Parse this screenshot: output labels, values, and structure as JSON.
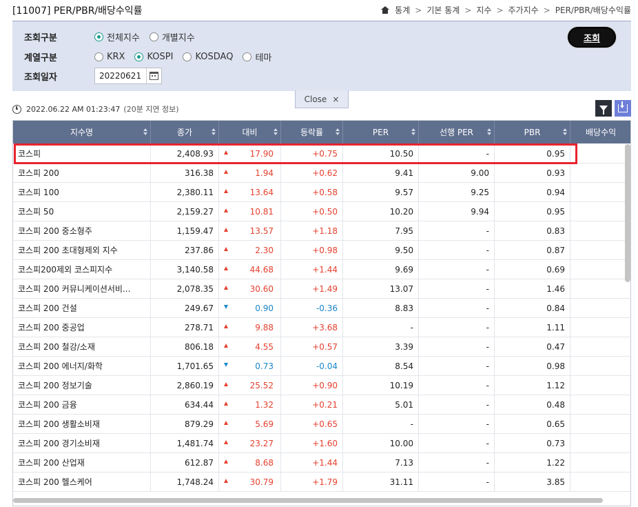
{
  "header": {
    "title": "[11007] PER/PBR/배당수익률",
    "breadcrumb": [
      "통계",
      "기본 통계",
      "지수",
      "주가지수",
      "PER/PBR/배당수익률"
    ]
  },
  "search": {
    "type_label": "조회구분",
    "type_options": [
      {
        "label": "전체지수",
        "checked": true
      },
      {
        "label": "개별지수",
        "checked": false
      }
    ],
    "series_label": "계열구분",
    "series_options": [
      {
        "label": "KRX",
        "checked": false
      },
      {
        "label": "KOSPI",
        "checked": true
      },
      {
        "label": "KOSDAQ",
        "checked": false
      },
      {
        "label": "테마",
        "checked": false
      }
    ],
    "date_label": "조회일자",
    "date_value": "20220621",
    "search_button": "조회",
    "close_tab": "Close"
  },
  "timestamp": {
    "time": "2022.06.22 AM 01:23:47",
    "note": "(20분 지연 정보)"
  },
  "table": {
    "columns": [
      "지수명",
      "종가",
      "대비",
      "등락률",
      "PER",
      "선행 PER",
      "PBR",
      "배당수익"
    ],
    "rows": [
      {
        "name": "코스피",
        "close": "2,408.93",
        "dir": "up",
        "change": "17.90",
        "rate": "+0.75",
        "per": "10.50",
        "fper": "-",
        "pbr": "0.95"
      },
      {
        "name": "코스피 200",
        "close": "316.38",
        "dir": "up",
        "change": "1.94",
        "rate": "+0.62",
        "per": "9.41",
        "fper": "9.00",
        "pbr": "0.93"
      },
      {
        "name": "코스피 100",
        "close": "2,380.11",
        "dir": "up",
        "change": "13.64",
        "rate": "+0.58",
        "per": "9.57",
        "fper": "9.25",
        "pbr": "0.94"
      },
      {
        "name": "코스피 50",
        "close": "2,159.27",
        "dir": "up",
        "change": "10.81",
        "rate": "+0.50",
        "per": "10.20",
        "fper": "9.94",
        "pbr": "0.95"
      },
      {
        "name": "코스피 200 중소형주",
        "close": "1,159.47",
        "dir": "up",
        "change": "13.57",
        "rate": "+1.18",
        "per": "7.95",
        "fper": "-",
        "pbr": "0.83"
      },
      {
        "name": "코스피 200 초대형제외 지수",
        "close": "237.86",
        "dir": "up",
        "change": "2.30",
        "rate": "+0.98",
        "per": "9.50",
        "fper": "-",
        "pbr": "0.87"
      },
      {
        "name": "코스피200제외 코스피지수",
        "close": "3,140.58",
        "dir": "up",
        "change": "44.68",
        "rate": "+1.44",
        "per": "9.69",
        "fper": "-",
        "pbr": "0.69"
      },
      {
        "name": "코스피 200 커뮤니케이션서비...",
        "close": "2,078.35",
        "dir": "up",
        "change": "30.60",
        "rate": "+1.49",
        "per": "13.07",
        "fper": "-",
        "pbr": "1.46"
      },
      {
        "name": "코스피 200 건설",
        "close": "249.67",
        "dir": "down",
        "change": "0.90",
        "rate": "-0.36",
        "per": "8.83",
        "fper": "-",
        "pbr": "0.84"
      },
      {
        "name": "코스피 200 중공업",
        "close": "278.71",
        "dir": "up",
        "change": "9.88",
        "rate": "+3.68",
        "per": "-",
        "fper": "-",
        "pbr": "1.11"
      },
      {
        "name": "코스피 200 철강/소재",
        "close": "806.18",
        "dir": "up",
        "change": "4.55",
        "rate": "+0.57",
        "per": "3.39",
        "fper": "-",
        "pbr": "0.47"
      },
      {
        "name": "코스피 200 에너지/화학",
        "close": "1,701.65",
        "dir": "down",
        "change": "0.73",
        "rate": "-0.04",
        "per": "8.54",
        "fper": "-",
        "pbr": "0.98"
      },
      {
        "name": "코스피 200 정보기술",
        "close": "2,860.19",
        "dir": "up",
        "change": "25.52",
        "rate": "+0.90",
        "per": "10.19",
        "fper": "-",
        "pbr": "1.12"
      },
      {
        "name": "코스피 200 금융",
        "close": "634.44",
        "dir": "up",
        "change": "1.32",
        "rate": "+0.21",
        "per": "5.01",
        "fper": "-",
        "pbr": "0.48"
      },
      {
        "name": "코스피 200 생활소비재",
        "close": "879.29",
        "dir": "up",
        "change": "5.69",
        "rate": "+0.65",
        "per": "-",
        "fper": "-",
        "pbr": "0.65"
      },
      {
        "name": "코스피 200 경기소비재",
        "close": "1,481.74",
        "dir": "up",
        "change": "23.27",
        "rate": "+1.60",
        "per": "10.00",
        "fper": "-",
        "pbr": "0.73"
      },
      {
        "name": "코스피 200 산업재",
        "close": "612.87",
        "dir": "up",
        "change": "8.68",
        "rate": "+1.44",
        "per": "7.13",
        "fper": "-",
        "pbr": "1.22"
      },
      {
        "name": "코스피 200 헬스케어",
        "close": "1,748.24",
        "dir": "up",
        "change": "30.79",
        "rate": "+1.79",
        "per": "31.11",
        "fper": "-",
        "pbr": "3.85"
      }
    ]
  },
  "colors": {
    "up": "#e5402e",
    "down": "#1a86c8",
    "header_bg": "#5f6f8e",
    "panel_bg": "#dde3f0",
    "highlight": "#e8232f"
  }
}
